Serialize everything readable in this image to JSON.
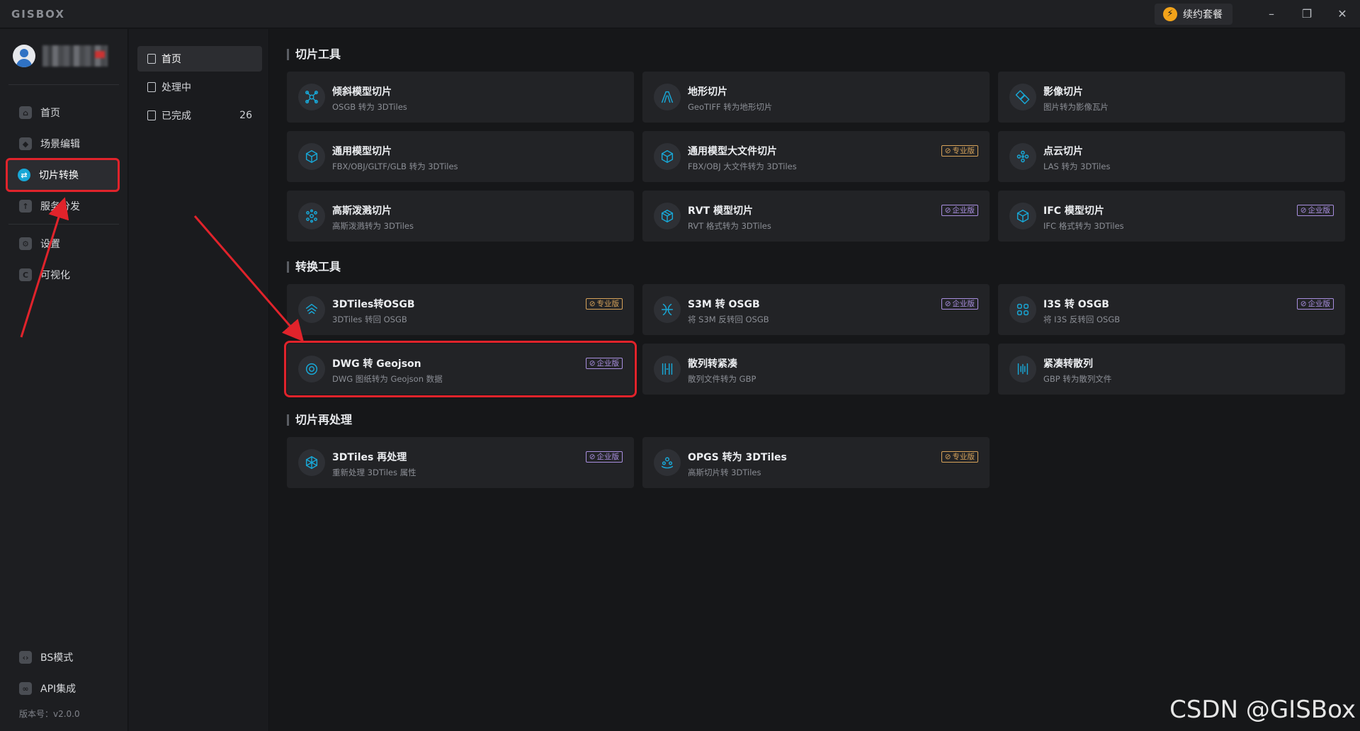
{
  "app": {
    "logo": "GISBOX",
    "renew_label": "续约套餐",
    "renew_icon": "⚡"
  },
  "window": {
    "minimize": "–",
    "restore": "❐",
    "close": "✕"
  },
  "sidebar": {
    "items_top": [
      {
        "label": "首页",
        "icon": "home-icon"
      },
      {
        "label": "场景编辑",
        "icon": "cube-icon"
      },
      {
        "label": "切片转换",
        "icon": "swap-icon"
      },
      {
        "label": "服务分发",
        "icon": "upload-icon"
      }
    ],
    "items_mid": [
      {
        "label": "设置",
        "icon": "gear-icon"
      },
      {
        "label": "可视化",
        "icon": "chart-icon"
      }
    ],
    "items_bottom": [
      {
        "label": "BS模式",
        "icon": "code-icon"
      },
      {
        "label": "API集成",
        "icon": "link-icon"
      }
    ],
    "version": "版本号：v2.0.0"
  },
  "subnav": {
    "items": [
      {
        "label": "首页",
        "count": ""
      },
      {
        "label": "处理中",
        "count": ""
      },
      {
        "label": "已完成",
        "count": "26"
      }
    ]
  },
  "sections": [
    {
      "title": "切片工具"
    },
    {
      "title": "转换工具"
    },
    {
      "title": "切片再处理"
    }
  ],
  "badges": {
    "pro": "专业版",
    "ent": "企业版"
  },
  "cards": [
    {
      "title": "倾斜模型切片",
      "sub": "OSGB 转为 3DTiles",
      "badge": ""
    },
    {
      "title": "地形切片",
      "sub": "GeoTIFF 转为地形切片",
      "badge": ""
    },
    {
      "title": "影像切片",
      "sub": "图片转为影像瓦片",
      "badge": ""
    },
    {
      "title": "通用模型切片",
      "sub": "FBX/OBJ/GLTF/GLB 转为 3DTiles",
      "badge": ""
    },
    {
      "title": "通用模型大文件切片",
      "sub": "FBX/OBJ 大文件转为 3DTiles",
      "badge": "专业版"
    },
    {
      "title": "点云切片",
      "sub": "LAS 转为 3DTiles",
      "badge": ""
    },
    {
      "title": "高斯泼溅切片",
      "sub": "高斯泼溅转为 3DTiles",
      "badge": ""
    },
    {
      "title": "RVT 模型切片",
      "sub": "RVT 格式转为 3DTiles",
      "badge": "企业版"
    },
    {
      "title": "IFC 模型切片",
      "sub": "IFC 格式转为 3DTiles",
      "badge": "企业版"
    },
    {
      "title": "3DTiles转OSGB",
      "sub": "3DTiles 转回 OSGB",
      "badge": "专业版"
    },
    {
      "title": "S3M 转 OSGB",
      "sub": "将 S3M 反转回 OSGB",
      "badge": "企业版"
    },
    {
      "title": "I3S 转 OSGB",
      "sub": "将 I3S 反转回 OSGB",
      "badge": "企业版"
    },
    {
      "title": "DWG 转 Geojson",
      "sub": "DWG 图纸转为 Geojson 数据",
      "badge": "企业版"
    },
    {
      "title": "散列转紧凑",
      "sub": "散列文件转为 GBP",
      "badge": ""
    },
    {
      "title": "紧凑转散列",
      "sub": "GBP 转为散列文件",
      "badge": ""
    },
    {
      "title": "3DTiles 再处理",
      "sub": "重新处理 3DTiles 属性",
      "badge": "企业版"
    },
    {
      "title": "OPGS 转为 3DTiles",
      "sub": "高斯切片转 3DTiles",
      "badge": "专业版"
    }
  ],
  "watermark": "CSDN @GISBox",
  "colors": {
    "accent": "#18a7d6",
    "highlight": "#e0232b",
    "pro": "#d7a35a",
    "ent": "#a98fe0"
  }
}
